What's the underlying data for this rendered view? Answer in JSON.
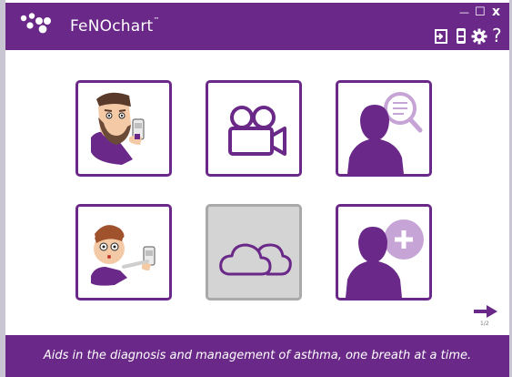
{
  "app": {
    "name": "FeNOchart",
    "trademark": "™"
  },
  "window_controls": {
    "minimize": "—",
    "maximize": "☐",
    "close": "x"
  },
  "toolbar": {
    "logout_icon": "logout-icon",
    "device_icon": "device-icon",
    "settings_icon": "gear-icon",
    "help_label": "?"
  },
  "tiles": [
    {
      "name": "adult-measurement",
      "icon": "adult-with-device",
      "enabled": true
    },
    {
      "name": "video-tutorial",
      "icon": "video-camera",
      "enabled": true
    },
    {
      "name": "patient-search",
      "icon": "person-magnifier",
      "enabled": true
    },
    {
      "name": "child-measurement",
      "icon": "child-with-device",
      "enabled": true
    },
    {
      "name": "cloud-sync",
      "icon": "cloud",
      "enabled": false
    },
    {
      "name": "add-patient",
      "icon": "person-plus",
      "enabled": true
    }
  ],
  "pagination": {
    "indicator": "1/2"
  },
  "footer": {
    "tagline": "Aids in the diagnosis and management of asthma, one breath at a time."
  },
  "colors": {
    "brand": "#6a2888",
    "brand_light": "#c7a4d6",
    "disabled_tile": "#d4d4d4"
  }
}
